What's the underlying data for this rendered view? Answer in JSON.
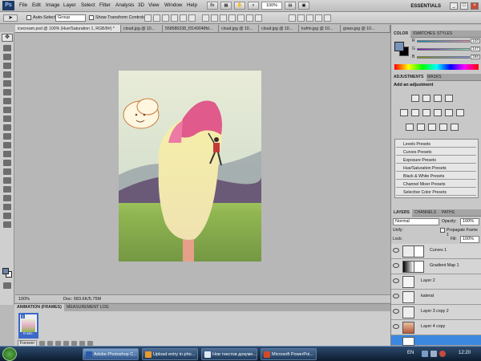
{
  "menubar": {
    "items": [
      "File",
      "Edit",
      "Image",
      "Layer",
      "Select",
      "Filter",
      "Analysis",
      "3D",
      "View",
      "Window",
      "Help"
    ],
    "zoom": "100%",
    "workspace": "ESSENTIALS"
  },
  "options": {
    "auto_select_label": "Auto-Select:",
    "auto_select_value": "Group",
    "transform_label": "Show Transform Controls"
  },
  "tabs": [
    "icecream.psd @ 100% (Hue/Saturation 1, RGB/8#) *",
    "cloud.jpg @ 10...",
    "558586338_f3149048fd...",
    "cloud.jpg @ 10...",
    "cloud.jpg @ 10...",
    "kufrin.jpg @ 10...",
    "grass.jpg @ 10..."
  ],
  "status": {
    "zoom": "100%",
    "doc": "Doc: 583.6K/5.75M"
  },
  "animation": {
    "tabs": [
      "ANIMATION (FRAMES)",
      "MEASUREMENT LOG"
    ],
    "frame_number": "1",
    "frame_duration": "0 sec.",
    "loop": "Forever"
  },
  "color_panel": {
    "tabs": [
      "COLOR",
      "SWATCHES",
      "STYLES"
    ],
    "r": "120",
    "g": "147",
    "b": "186",
    "fg": "#7893ba"
  },
  "adjustments": {
    "tabs": [
      "ADJUSTMENTS",
      "MASKS"
    ],
    "title": "Add an adjustment",
    "presets": [
      "Levels Presets",
      "Curves Presets",
      "Exposure Presets",
      "Hue/Saturation Presets",
      "Black & White Presets",
      "Channel Mixer Presets",
      "Selective Color Presets"
    ]
  },
  "layers_panel": {
    "tabs": [
      "LAYERS",
      "CHANNELS",
      "PATHS"
    ],
    "blend": "Normal",
    "opacity_label": "Opacity:",
    "opacity": "100%",
    "unify_label": "Unify:",
    "propagate": "Propagate Frame 1",
    "lock_label": "Lock:",
    "fill_label": "Fill:",
    "fill": "100%",
    "layers": [
      "Curves 1",
      "Gradient Map 1",
      "Layer 2",
      "katerat",
      "Layer 3 copy 2",
      "Layer 4 copy",
      ""
    ]
  },
  "taskbar": {
    "tasks": [
      "Adobe Photoshop C...",
      "Upload entry in pho...",
      "Нов текстов докуме...",
      "Microsoft PowerPoi..."
    ],
    "lang": "EN",
    "time": "12:20"
  },
  "colors": {
    "accent": "#3b88e0",
    "panel": "#c8c8c8",
    "canvas_bg": "#b7b7b7"
  }
}
